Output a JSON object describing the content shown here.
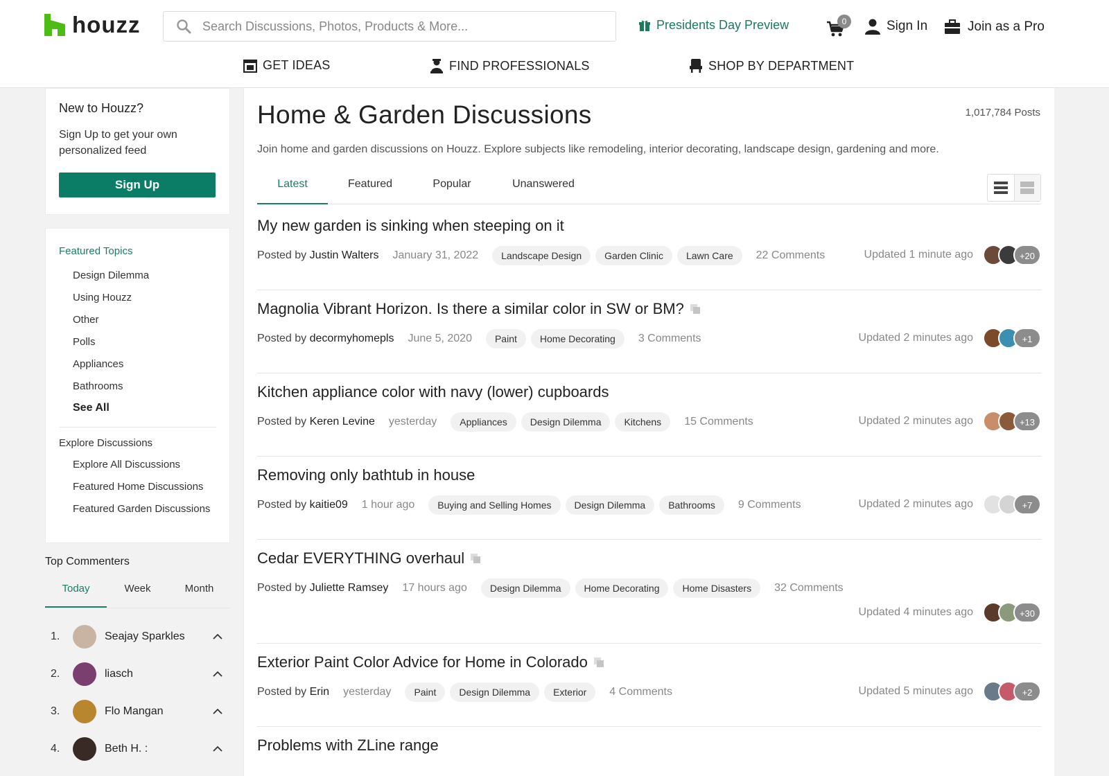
{
  "header": {
    "logo_text": "houzz",
    "search_placeholder": "Search Discussions, Photos, Products & More...",
    "promo_label": "Presidents Day Preview",
    "cart_count": "0",
    "sign_in": "Sign In",
    "join_pro": "Join as a Pro",
    "nav": [
      {
        "label": "GET IDEAS",
        "icon": "gallery-icon"
      },
      {
        "label": "FIND PROFESSIONALS",
        "icon": "professional-icon"
      },
      {
        "label": "SHOP BY DEPARTMENT",
        "icon": "chair-icon"
      }
    ],
    "brand_color": "#4dbc15",
    "accent_color": "#1b7d63"
  },
  "sidebar": {
    "new_title": "New to Houzz?",
    "new_text": "Sign Up to get your own personalized feed",
    "signup_label": "Sign Up",
    "featured_heading": "Featured Topics",
    "featured_topics": [
      "Design Dilemma",
      "Using Houzz",
      "Other",
      "Polls",
      "Appliances",
      "Bathrooms"
    ],
    "see_all": "See All",
    "explore_heading": "Explore Discussions",
    "explore_links": [
      "Explore All Discussions",
      "Featured Home Discussions",
      "Featured Garden Discussions"
    ],
    "top_commenters_title": "Top Commenters",
    "tc_tabs": [
      "Today",
      "Week",
      "Month"
    ],
    "commenters": [
      {
        "rank": "1.",
        "name": "Seajay Sparkles",
        "color": "#c9b3a3"
      },
      {
        "rank": "2.",
        "name": "liasch",
        "color": "#7a3f6e"
      },
      {
        "rank": "3.",
        "name": "Flo Mangan",
        "color": "#b8862f"
      },
      {
        "rank": "4.",
        "name": "Beth H. :",
        "color": "#3a2a26"
      }
    ]
  },
  "main": {
    "title": "Home & Garden Discussions",
    "posts_count": "1,017,784 Posts",
    "intro": "Join home and garden discussions on Houzz. Explore subjects like remodeling, interior decorating, landscape design, gardening and more.",
    "tabs": [
      "Latest",
      "Featured",
      "Popular",
      "Unanswered"
    ],
    "posts": [
      {
        "title": "My new garden is sinking when steeping on it",
        "posted_prefix": "Posted by",
        "author": "Justin Walters",
        "date": "January 31, 2022",
        "tags": [
          "Landscape Design",
          "Garden Clinic",
          "Lawn Care"
        ],
        "comments": "22 Comments",
        "updated": "Updated 1 minute ago",
        "more": "+20",
        "has_copy": false,
        "avatar_colors": [
          "#6b4a3a",
          "#3b3b3b"
        ]
      },
      {
        "title": "Magnolia Vibrant Horizon. Is there a similar color in SW or BM?",
        "posted_prefix": "Posted by",
        "author": "decormyhomepls",
        "date": "June 5, 2020",
        "tags": [
          "Paint",
          "Home Decorating"
        ],
        "comments": "3 Comments",
        "updated": "Updated 2 minutes ago",
        "more": "+1",
        "has_copy": true,
        "avatar_colors": [
          "#7a4a2a",
          "#3c8fb0"
        ]
      },
      {
        "title": "Kitchen appliance color with navy (lower) cupboards",
        "posted_prefix": "Posted by",
        "author": "Keren Levine",
        "date": "yesterday",
        "tags": [
          "Appliances",
          "Design Dilemma",
          "Kitchens"
        ],
        "comments": "15 Comments",
        "updated": "Updated 2 minutes ago",
        "more": "+13",
        "has_copy": false,
        "avatar_colors": [
          "#c98d6a",
          "#8a5a3a"
        ]
      },
      {
        "title": "Removing only bathtub in house",
        "posted_prefix": "Posted by",
        "author": "kaitie09",
        "date": "1 hour ago",
        "tags": [
          "Buying and Selling Homes",
          "Design Dilemma",
          "Bathrooms"
        ],
        "comments": "9 Comments",
        "updated": "Updated 2 minutes ago",
        "more": "+7",
        "has_copy": false,
        "avatar_colors": [
          "#e2e2e2",
          "#d4d4d4"
        ]
      },
      {
        "title": "Cedar EVERYTHING overhaul",
        "posted_prefix": "Posted by",
        "author": "Juliette Ramsey",
        "date": "17 hours ago",
        "tags": [
          "Design Dilemma",
          "Home Decorating",
          "Home Disasters"
        ],
        "comments": "32 Comments",
        "updated": "Updated 4 minutes ago",
        "more": "+30",
        "has_copy": true,
        "avatar_colors": [
          "#5a3a2a",
          "#8a9a7a"
        ]
      },
      {
        "title": "Exterior Paint Color Advice for Home in Colorado",
        "posted_prefix": "Posted by",
        "author": "Erin",
        "date": "yesterday",
        "tags": [
          "Paint",
          "Design Dilemma",
          "Exterior"
        ],
        "comments": "4 Comments",
        "updated": "Updated 5 minutes ago",
        "more": "+2",
        "has_copy": true,
        "avatar_colors": [
          "#6a7a8a",
          "#c45a6a"
        ]
      },
      {
        "title": "Problems with ZLine range",
        "posted_prefix": "",
        "author": "",
        "date": "",
        "tags": [],
        "comments": "",
        "updated": "",
        "more": "",
        "has_copy": false,
        "avatar_colors": []
      }
    ]
  }
}
